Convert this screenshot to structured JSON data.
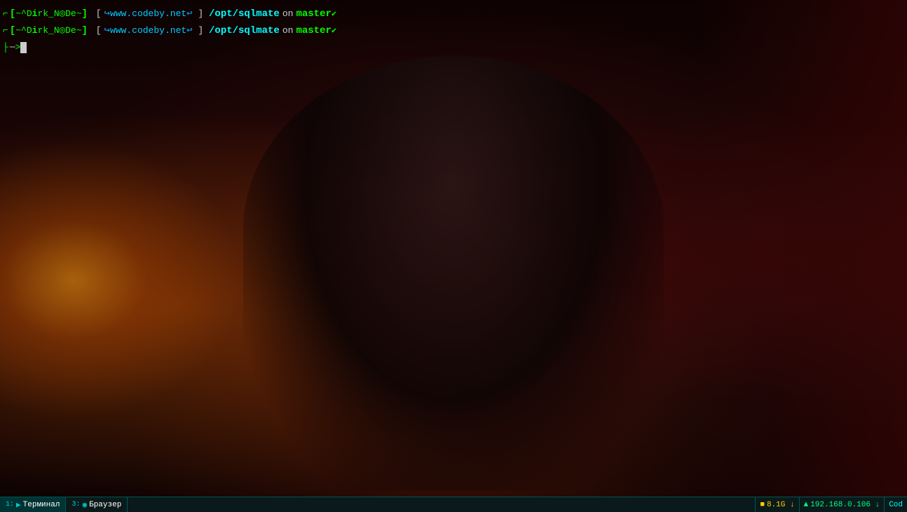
{
  "terminal": {
    "lines": [
      {
        "id": "line1",
        "prefix_bracket_open": "[",
        "prefix_dash": "-",
        "username": "~^D𝐢rk_N◎De~",
        "bracket_close": "]",
        "git_arrow": "↪",
        "url": "www.codeby.net",
        "url_arrow": "↩",
        "bracket2_open": "[",
        "bracket2_close": "]",
        "path": "/opt/sqlmate",
        "on": "on",
        "branch": "master",
        "branch_symbol": "✔"
      },
      {
        "id": "line2",
        "prefix_bracket_open": "[",
        "prefix_dash": "-",
        "username": "~^D𝐢rk_N◎De~",
        "bracket_close": "]",
        "git_arrow": "↪",
        "url": "www.codeby.net",
        "url_arrow": "↩",
        "bracket2_open": "[",
        "bracket2_close": "]",
        "path": "/opt/sqlmate",
        "on": "on",
        "branch": "master",
        "branch_symbol": "✔"
      }
    ],
    "cursor_line": 3
  },
  "taskbar": {
    "items": [
      {
        "id": "terminal",
        "num": "1",
        "icon": "▶",
        "label": "Терминал",
        "active": true
      },
      {
        "id": "browser",
        "num": "3",
        "icon": "◉",
        "label": "Браузер",
        "active": false
      }
    ],
    "right_items": [
      {
        "id": "storage",
        "icon": "■",
        "label": "8.1G ↓",
        "color": "yellow"
      },
      {
        "id": "wifi",
        "icon": "▲",
        "label": "192.168.0.106 ↓",
        "color": "green"
      },
      {
        "id": "cod",
        "icon": "",
        "label": "Cod",
        "color": "cyan"
      }
    ]
  },
  "colors": {
    "bg": "#0a0000",
    "terminal_bg": "rgba(0,0,0,0.15)",
    "green": "#00ff00",
    "cyan": "#00ffff",
    "blue": "#00aaff",
    "white": "#cccccc",
    "taskbar_bg": "#0a1a1a"
  }
}
